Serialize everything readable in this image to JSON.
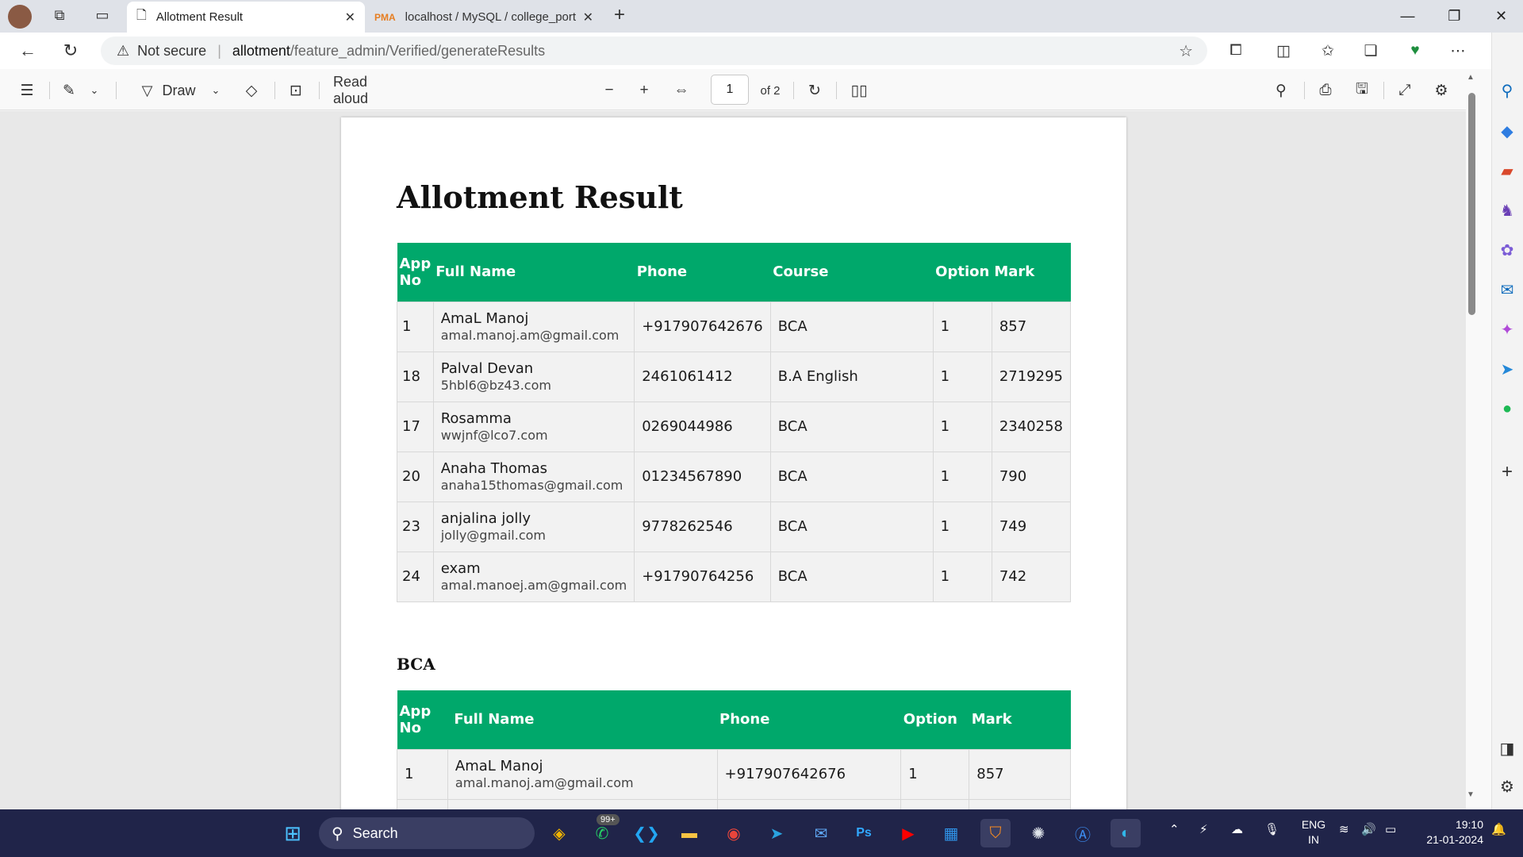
{
  "browser": {
    "tabs": [
      {
        "title": "Allotment Result",
        "active": true,
        "icon": "page-icon"
      },
      {
        "title": "localhost / MySQL / college_port",
        "active": false,
        "icon": "phpmyadmin-icon"
      }
    ],
    "address": {
      "security_label": "Not secure",
      "url_host": "allotment",
      "url_path": "/feature_admin/Verified/generateResults"
    }
  },
  "pdf_toolbar": {
    "draw_label": "Draw",
    "read_aloud_label": "Read aloud",
    "page_number": "1",
    "page_total": "of 2"
  },
  "document": {
    "title": "Allotment Result",
    "main_table": {
      "headers": [
        "App No",
        "Full Name",
        "Phone",
        "Course",
        "Option",
        "Mark"
      ],
      "rows": [
        {
          "app_no": "1",
          "name": "AmaL Manoj",
          "email": "amal.manoj.am@gmail.com",
          "phone": "+917907642676",
          "course": "BCA",
          "option": "1",
          "mark": "857"
        },
        {
          "app_no": "18",
          "name": "Palval Devan",
          "email": "5hbl6@bz43.com",
          "phone": "2461061412",
          "course": "B.A English",
          "option": "1",
          "mark": "2719295"
        },
        {
          "app_no": "17",
          "name": "Rosamma",
          "email": "wwjnf@lco7.com",
          "phone": "0269044986",
          "course": "BCA",
          "option": "1",
          "mark": "2340258"
        },
        {
          "app_no": "20",
          "name": "Anaha Thomas",
          "email": "anaha15thomas@gmail.com",
          "phone": "01234567890",
          "course": "BCA",
          "option": "1",
          "mark": "790"
        },
        {
          "app_no": "23",
          "name": "anjalina jolly",
          "email": "jolly@gmail.com",
          "phone": "9778262546",
          "course": "BCA",
          "option": "1",
          "mark": "749"
        },
        {
          "app_no": "24",
          "name": "exam",
          "email": "amal.manoej.am@gmail.com",
          "phone": "+91790764256",
          "course": "BCA",
          "option": "1",
          "mark": "742"
        }
      ]
    },
    "section_title": "BCA",
    "bca_table": {
      "headers": [
        "App No",
        "Full Name",
        "Phone",
        "Option",
        "Mark"
      ],
      "rows": [
        {
          "app_no": "1",
          "name": "AmaL Manoj",
          "email": "amal.manoj.am@gmail.com",
          "phone": "+917907642676",
          "option": "1",
          "mark": "857"
        }
      ]
    }
  },
  "taskbar": {
    "search_label": "Search",
    "whatsapp_badge": "99+",
    "lang_top": "ENG",
    "lang_bottom": "IN",
    "time": "19:10",
    "date": "21-01-2024"
  },
  "colors": {
    "table_header": "#00a86b",
    "taskbar": "#202449",
    "edge_accent": "#0f6cbd"
  }
}
